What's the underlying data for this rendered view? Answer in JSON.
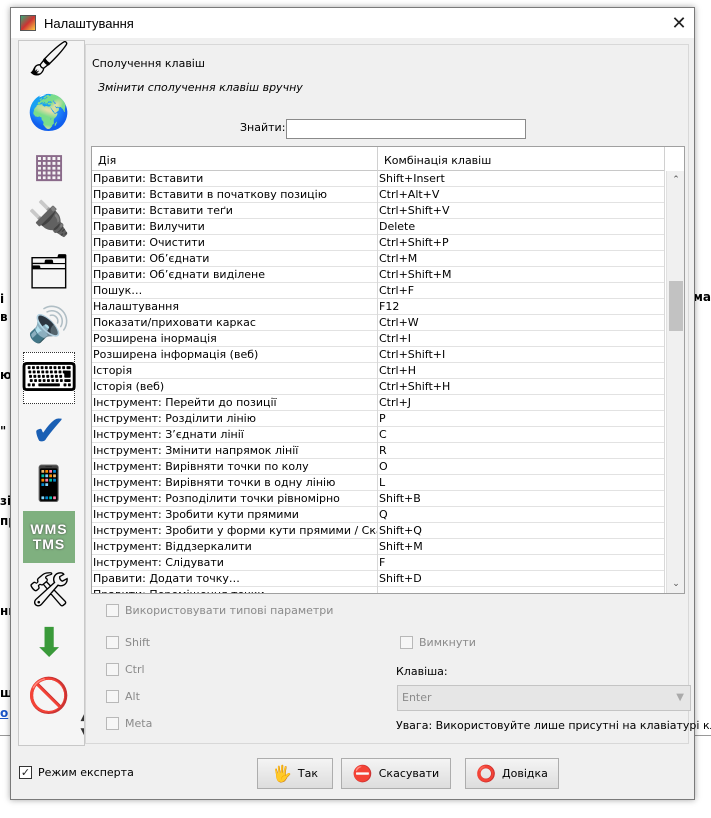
{
  "window": {
    "title": "Налаштування",
    "close_glyph": "✕"
  },
  "background": {
    "frags_left": [
      "і",
      "в",
      "ю",
      "\"",
      "зі",
      "пр",
      "ни",
      "щ",
      "о"
    ],
    "frag_right": "ма"
  },
  "tabs": [
    {
      "icon": "paintbrush-icon",
      "glyph": "🖌"
    },
    {
      "icon": "globe-icon",
      "glyph": "🌍"
    },
    {
      "icon": "grid-map-icon",
      "glyph": "▦"
    },
    {
      "icon": "plug-icon",
      "glyph": "🔌"
    },
    {
      "icon": "folders-icon",
      "glyph": "🗂"
    },
    {
      "icon": "speaker-icon",
      "glyph": "🔊"
    },
    {
      "icon": "keyboard-icon",
      "glyph": "⌨"
    },
    {
      "icon": "checkmark-icon",
      "glyph": "✔"
    },
    {
      "icon": "remote-control-icon",
      "glyph": "📱"
    },
    {
      "icon": "wms-tms-icon",
      "text": "WMS\nTMS"
    },
    {
      "icon": "tools-icon",
      "glyph": "🛠"
    },
    {
      "icon": "download-icon",
      "glyph": "⬇"
    },
    {
      "icon": "no-phone-icon",
      "glyph": "🚫"
    }
  ],
  "strip_scroll": {
    "up": "▲",
    "down": "▼"
  },
  "section": {
    "title": "Сполучення клавіш",
    "description": "Змінити сполучення клавіш вручну",
    "search_label": "Знайти:",
    "search_value": ""
  },
  "table": {
    "columns": [
      "Дія",
      "Комбінація клавіш"
    ],
    "rows": [
      [
        "Правити: Вставити",
        "Shift+Insert"
      ],
      [
        "Правити: Вставити в початкову позицію",
        "Ctrl+Alt+V"
      ],
      [
        "Правити: Вставити теґи",
        "Ctrl+Shift+V"
      ],
      [
        "Правити: Вилучити",
        "Delete"
      ],
      [
        "Правити: Очистити",
        "Ctrl+Shift+P"
      ],
      [
        "Правити: Об’єднати",
        "Ctrl+M"
      ],
      [
        "Правити: Об’єднати виділене",
        "Ctrl+Shift+M"
      ],
      [
        "Пошук…",
        "Ctrl+F"
      ],
      [
        "Налаштування",
        "F12"
      ],
      [
        "Показати/приховати каркас",
        "Ctrl+W"
      ],
      [
        "Розширена інормація",
        "Ctrl+I"
      ],
      [
        "Розширена інформація (веб)",
        "Ctrl+Shift+I"
      ],
      [
        "Історія",
        "Ctrl+H"
      ],
      [
        "Історія (веб)",
        "Ctrl+Shift+H"
      ],
      [
        "Інструмент: Перейти до позиції",
        "Ctrl+J"
      ],
      [
        "Інструмент: Розділити лінію",
        "P"
      ],
      [
        "Інструмент: З’єднати лінії",
        "C"
      ],
      [
        "Інструмент: Змінити напрямок лінії",
        "R"
      ],
      [
        "Інструмент: Вирівняти точки по колу",
        "O"
      ],
      [
        "Інструмент: Вирівняти точки в одну лінію",
        "L"
      ],
      [
        "Інструмент: Розподілити точки рівномірно",
        "Shift+B"
      ],
      [
        "Інструмент: Зробити кути прямими",
        "Q"
      ],
      [
        "Інструмент: Зробити у форми кути прямими / Скасув…",
        "Shift+Q"
      ],
      [
        "Інструмент: Віддзеркалити",
        "Shift+M"
      ],
      [
        "Інструмент: Слідувати",
        "F"
      ],
      [
        "Правити: Додати точку…",
        "Shift+D"
      ],
      [
        "Правити: Переміщення точки",
        ""
      ]
    ],
    "scroll_up": "⌃",
    "scroll_down": "⌄"
  },
  "options": {
    "use_defaults": "Використовувати типові параметри",
    "shift": "Shift",
    "ctrl": "Ctrl",
    "alt": "Alt",
    "meta": "Meta",
    "disabled": "Вимкнути",
    "key_label": "Клавіша:",
    "key_value": "Enter",
    "note": "Увага: Використовуйте лише присутні на клавіатурі кл..."
  },
  "footer": {
    "expert_mode": "Режим експерта",
    "expert_checked": "✓",
    "ok_label": "Так",
    "cancel_label": "Скасувати",
    "help_label": "Довідка",
    "ok_icon": "🖐",
    "cancel_icon": "⛔",
    "help_icon": "⭕"
  }
}
